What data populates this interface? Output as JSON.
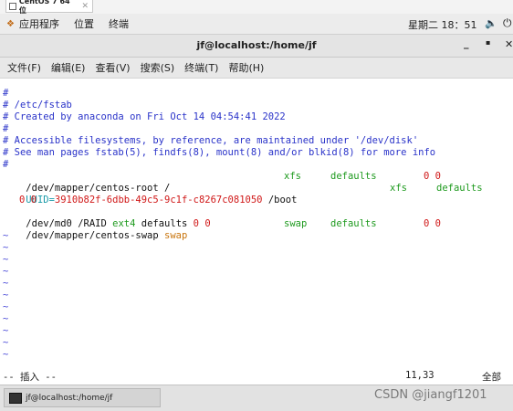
{
  "vm_tab": {
    "label": "CentOS 7 64 位",
    "close": "✕"
  },
  "topbar": {
    "apps_label": "应用程序",
    "places_label": "位置",
    "terminal_label": "终端",
    "clock": "星期二 18：51",
    "volume_icon": "volume-icon",
    "power_icon": "power-icon"
  },
  "window": {
    "title": "jf@localhost:/home/jf",
    "minimize": "_",
    "maximize": "▪",
    "close": "✕"
  },
  "menubar": {
    "items": [
      "文件(F)",
      "编辑(E)",
      "查看(V)",
      "搜索(S)",
      "终端(T)",
      "帮助(H)"
    ]
  },
  "editor": {
    "comments": [
      "#",
      "# /etc/fstab",
      "# Created by anaconda on Fri Oct 14 04:54:41 2022",
      "#",
      "# Accessible filesystems, by reference, are maintained under '/dev/disk'",
      "# See man pages fstab(5), findfs(8), mount(8) and/or blkid(8) for more info",
      "#"
    ],
    "entries": {
      "root": {
        "device": "/dev/mapper/centos-root",
        "mount": "/",
        "type": "xfs",
        "options": "defaults",
        "dump": "0 0"
      },
      "boot": {
        "key": "UUID=",
        "uuid": "3910b82f-6dbb-49c5-9c1f-c8267c081050",
        "mount": "/boot",
        "type": "xfs",
        "options": "defaults",
        "dump": "0 0"
      },
      "raid": {
        "device": "/dev/md0",
        "mount": "/RAID",
        "type": "ext4",
        "options": "defaults",
        "dump": "0 0"
      },
      "swap": {
        "device": "/dev/mapper/centos-swap",
        "mount": "swap",
        "type": "swap",
        "options": "defaults",
        "dump": "0 0"
      }
    },
    "tilde": "~",
    "mode": "-- 插入 --",
    "position": "11,33",
    "scroll": "全部"
  },
  "taskbar": {
    "task_label": "jf@localhost:/home/jf",
    "watermark": "CSDN @jiangf1201"
  }
}
